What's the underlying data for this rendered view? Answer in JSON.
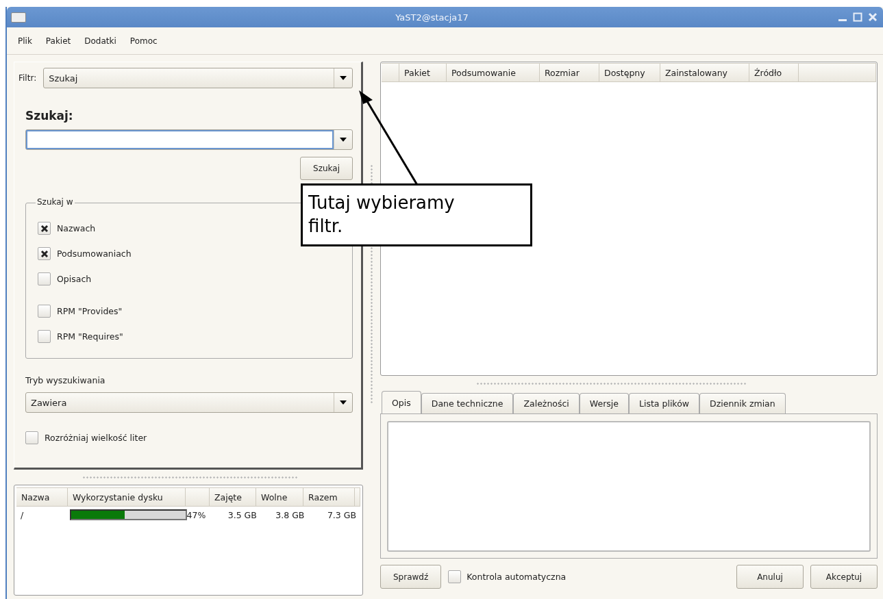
{
  "window": {
    "title": "YaST2@stacja17"
  },
  "menu": [
    "Plik",
    "Pakiet",
    "Dodatki",
    "Pomoc"
  ],
  "filter": {
    "label": "Filtr:",
    "value": "Szukaj"
  },
  "search": {
    "heading": "Szukaj:",
    "button": "Szukaj"
  },
  "search_in": {
    "title": "Szukaj w",
    "options": [
      {
        "label": "Nazwach",
        "checked": true
      },
      {
        "label": "Podsumowaniach",
        "checked": true
      },
      {
        "label": "Opisach",
        "checked": false
      },
      {
        "label": "RPM \"Provides\"",
        "checked": false
      },
      {
        "label": "RPM \"Requires\"",
        "checked": false
      }
    ]
  },
  "search_mode": {
    "label": "Tryb wyszukiwania",
    "value": "Zawiera"
  },
  "case_sensitive": {
    "label": "Rozróżniaj wielkość liter",
    "checked": false
  },
  "disk_table": {
    "columns": [
      "Nazwa",
      "Wykorzystanie dysku",
      "Zajęte",
      "Wolne",
      "Razem"
    ],
    "rows": [
      {
        "name": "/",
        "level": 0.47,
        "percent": "47%",
        "used": "3.5 GB",
        "free": "3.8 GB",
        "total": "7.3 GB"
      }
    ]
  },
  "package_table": {
    "columns": [
      "Pakiet",
      "Podsumowanie",
      "Rozmiar",
      "Dostępny",
      "Zainstalowany",
      "Źródło"
    ]
  },
  "tabs": [
    {
      "label": "Opis",
      "selected": true
    },
    {
      "label": "Dane techniczne",
      "selected": false
    },
    {
      "label": "Zależności",
      "selected": false
    },
    {
      "label": "Wersje",
      "selected": false
    },
    {
      "label": "Lista plików",
      "selected": false
    },
    {
      "label": "Dziennik zmian",
      "selected": false
    }
  ],
  "bottom_bar": {
    "check_button": "Sprawdź",
    "auto_check": {
      "label": "Kontrola automatyczna",
      "checked": false
    },
    "cancel": "Anuluj",
    "accept": "Akceptuj"
  },
  "callout": {
    "text": "Tutaj wybieramy filtr."
  }
}
